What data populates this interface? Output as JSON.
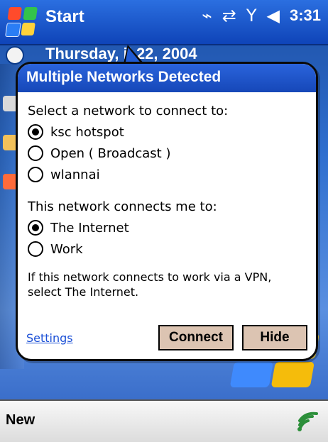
{
  "topbar": {
    "start_label": "Start",
    "time": "3:31",
    "icons": [
      "antenna-icon",
      "connectivity-icon",
      "signal-icon",
      "volume-icon"
    ]
  },
  "today": {
    "date_visible": "Thursday,    il 22, 2004"
  },
  "dialog": {
    "title": "Multiple Networks Detected",
    "select_label": "Select a network to connect to:",
    "networks": [
      {
        "label": "ksc hotspot",
        "selected": true
      },
      {
        "label": "Open ( Broadcast )",
        "selected": false
      },
      {
        "label": "wlannai",
        "selected": false
      }
    ],
    "connects_label": "This network connects me to:",
    "destinations": [
      {
        "label": "The Internet",
        "selected": true
      },
      {
        "label": "Work",
        "selected": false
      }
    ],
    "note": "If this network connects to work via a VPN, select The Internet.",
    "settings_link": "Settings",
    "connect_button": "Connect",
    "hide_button": "Hide"
  },
  "bottombar": {
    "new_label": "New"
  },
  "colors": {
    "title_blue": "#1f5bd3",
    "button_fill": "#dcc4b2",
    "link_blue": "#1a4fd6"
  }
}
